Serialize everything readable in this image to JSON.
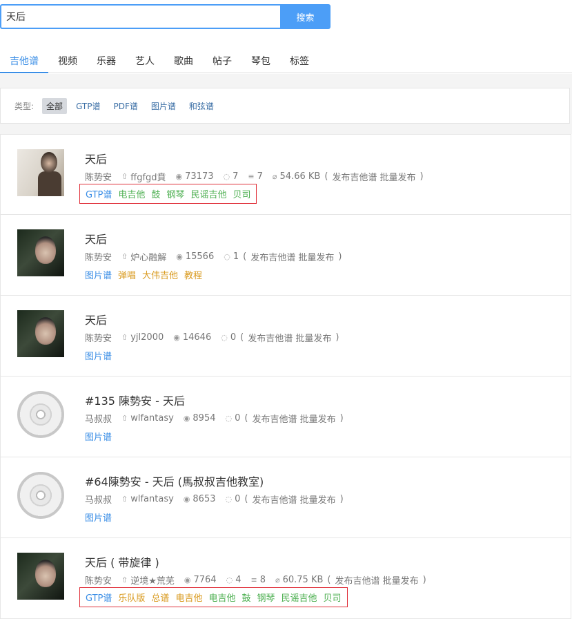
{
  "search": {
    "value": "天后",
    "button_label": "搜索"
  },
  "tabs": [
    {
      "label": "吉他谱",
      "active": true
    },
    {
      "label": "视频"
    },
    {
      "label": "乐器"
    },
    {
      "label": "艺人"
    },
    {
      "label": "歌曲"
    },
    {
      "label": "帖子"
    },
    {
      "label": "琴包"
    },
    {
      "label": "标签"
    }
  ],
  "filter": {
    "label": "类型:",
    "options": [
      {
        "label": "全部",
        "active": true
      },
      {
        "label": "GTP谱"
      },
      {
        "label": "PDF谱"
      },
      {
        "label": "图片谱"
      },
      {
        "label": "和弦谱"
      }
    ]
  },
  "colors": {
    "accent": "#4c9ef7",
    "tag_blue": "#3a8ee6",
    "tag_green": "#4caf50",
    "tag_orange": "#d99a1e",
    "highlight_box": "#e0303a"
  },
  "results": [
    {
      "thumb": "album-light",
      "title": "天后",
      "artist": "陈势安",
      "uploader": "ffgfgd賁",
      "views": "73173",
      "comments": "7",
      "tracks": "7",
      "size": "54.66 KB",
      "status": "发布吉他谱 批量发布",
      "boxed": true,
      "tags": [
        {
          "t": "GTP谱",
          "c": "blue"
        },
        {
          "t": "电吉他",
          "c": "green"
        },
        {
          "t": "鼓",
          "c": "green"
        },
        {
          "t": "钢琴",
          "c": "green"
        },
        {
          "t": "民谣吉他",
          "c": "green"
        },
        {
          "t": "贝司",
          "c": "green"
        }
      ]
    },
    {
      "thumb": "album-photo",
      "title": "天后",
      "artist": "陈势安",
      "uploader": "炉心融解",
      "views": "15566",
      "comments": "1",
      "status": "发布吉他谱 批量发布",
      "tags": [
        {
          "t": "图片谱",
          "c": "blue"
        },
        {
          "t": "弹唱",
          "c": "orange"
        },
        {
          "t": "大伟吉他",
          "c": "orange"
        },
        {
          "t": "教程",
          "c": "orange"
        }
      ]
    },
    {
      "thumb": "album-photo",
      "title": "天后",
      "artist": "陈势安",
      "uploader": "yjl2000",
      "views": "14646",
      "comments": "0",
      "status": "发布吉他谱 批量发布",
      "tags": [
        {
          "t": "图片谱",
          "c": "blue"
        }
      ]
    },
    {
      "thumb": "cd",
      "title": "#135 陳勢安 - 天后",
      "artist": "马叔叔",
      "uploader": "wlfantasy",
      "views": "8954",
      "comments": "0",
      "status": "发布吉他谱 批量发布",
      "tags": [
        {
          "t": "图片谱",
          "c": "blue"
        }
      ]
    },
    {
      "thumb": "cd",
      "title": "#64陳勢安 - 天后 (馬叔叔吉他教室)",
      "artist": "马叔叔",
      "uploader": "wlfantasy",
      "views": "8653",
      "comments": "0",
      "status": "发布吉他谱 批量发布",
      "tags": [
        {
          "t": "图片谱",
          "c": "blue"
        }
      ]
    },
    {
      "thumb": "album-photo",
      "title": "天后 ( 带旋律 )",
      "artist": "陈势安",
      "uploader": "逆境★荒芜",
      "views": "7764",
      "comments": "4",
      "tracks": "8",
      "size": "60.75 KB",
      "status": "发布吉他谱 批量发布",
      "boxed": true,
      "tags": [
        {
          "t": "GTP谱",
          "c": "blue"
        },
        {
          "t": "乐队版",
          "c": "orange"
        },
        {
          "t": "总谱",
          "c": "orange"
        },
        {
          "t": "电吉他",
          "c": "orange"
        },
        {
          "t": "电吉他",
          "c": "green"
        },
        {
          "t": "鼓",
          "c": "green"
        },
        {
          "t": "钢琴",
          "c": "green"
        },
        {
          "t": "民谣吉他",
          "c": "green"
        },
        {
          "t": "贝司",
          "c": "green"
        }
      ]
    }
  ]
}
